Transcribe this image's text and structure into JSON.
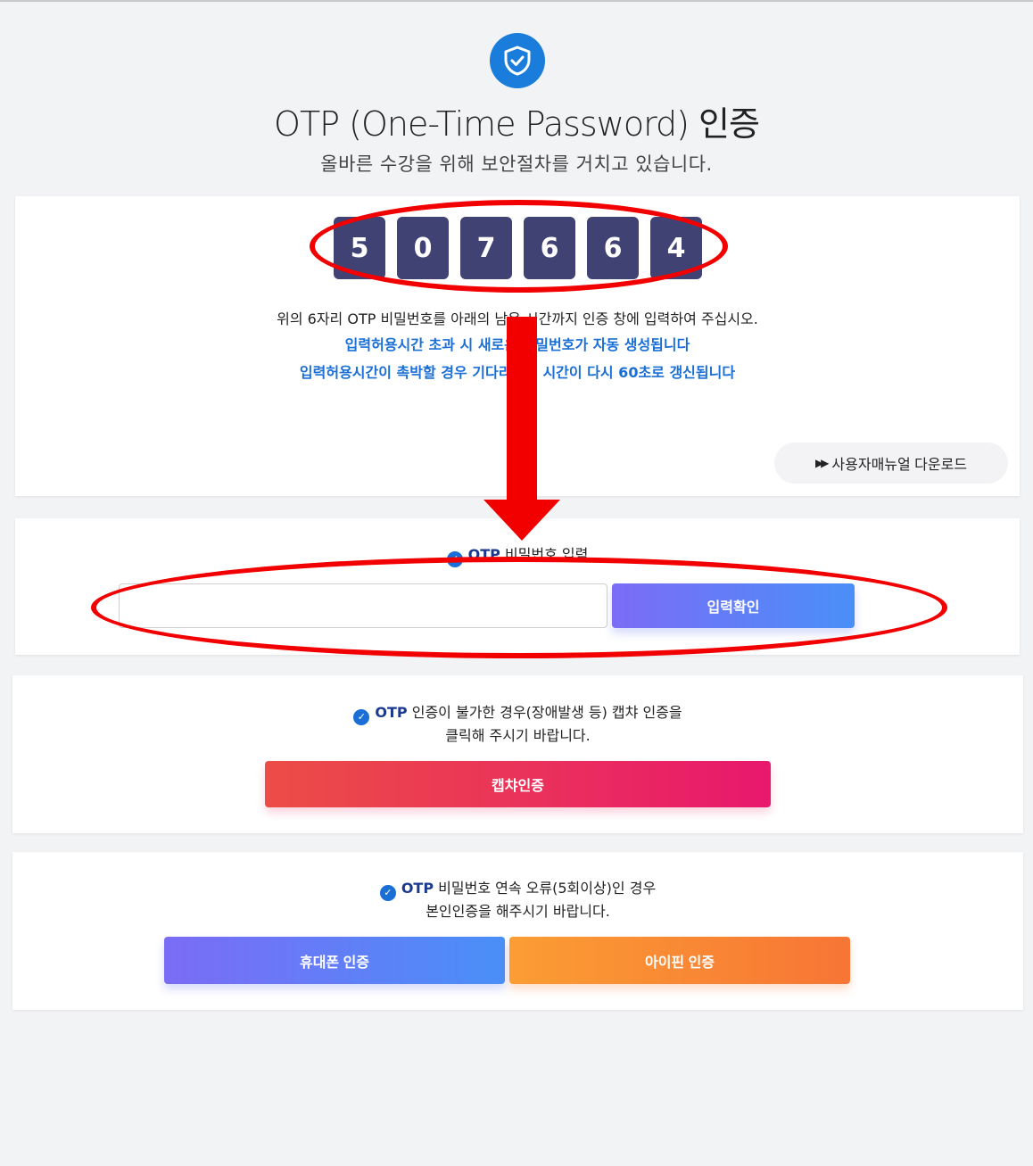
{
  "header": {
    "title": "OTP (One-Time Password) 인증",
    "subtitle": "올바른 수강을 위해 보안절차를 거치고 있습니다."
  },
  "otp_panel": {
    "digits": [
      "5",
      "0",
      "7",
      "6",
      "6",
      "4"
    ],
    "instruction": "위의 6자리 OTP 비밀번호를 아래의 남은 시간까지 인증 창에 입력하여 주십시오.",
    "notice_1": "입력허용시간 초과 시 새로운 비밀번호가 자동 생성됩니다",
    "notice_2": "입력허용시간이 촉박할 경우 기다리시면 시간이 다시 60초로 갱신됩니다",
    "manual_button": "사용자매뉴얼 다운로드"
  },
  "input_panel": {
    "label_otp": "OTP",
    "label_rest": "비밀번호 입력",
    "input_value": "",
    "confirm_button": "입력확인"
  },
  "captcha_panel": {
    "label_otp": "OTP",
    "line_1": "인증이 불가한 경우(장애발생 등) 캡챠 인증을",
    "line_2": "클릭해 주시기 바랍니다.",
    "button": "캡챠인증"
  },
  "identity_panel": {
    "label_otp": "OTP",
    "line_1": "비밀번호 연속 오류(5회이상)인 경우",
    "line_2": "본인인증을 해주시기 바랍니다.",
    "phone_button": "휴대폰 인증",
    "ipin_button": "아이핀 인증"
  },
  "colors": {
    "accent_blue": "#1a6fd6",
    "digit_bg": "#414274",
    "annotation_red": "#f20000"
  },
  "icons": {
    "header": "shield-check-icon",
    "check": "check-circle-icon",
    "manual": "double-arrow-icon"
  }
}
